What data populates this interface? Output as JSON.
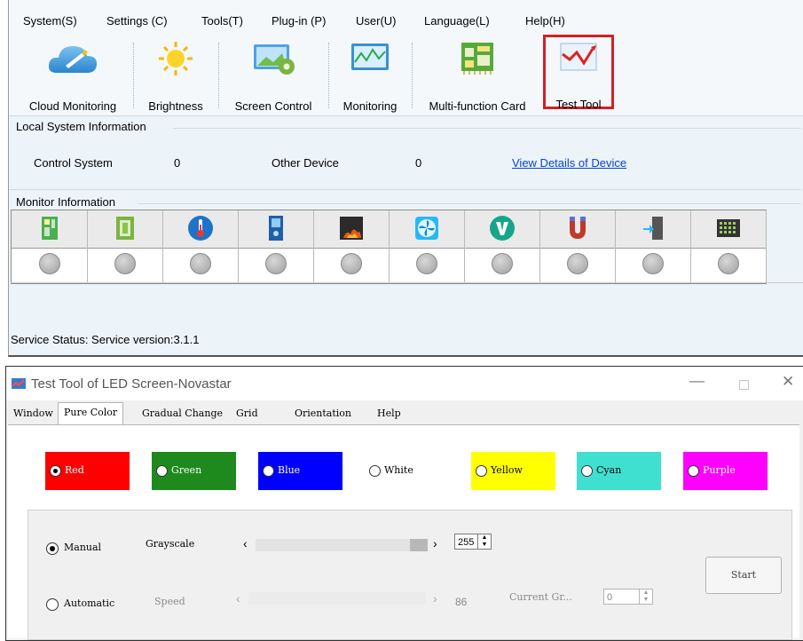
{
  "main_window": {
    "menu": [
      {
        "label": "System(S)"
      },
      {
        "label": "Settings (C)"
      },
      {
        "label": "Tools(T)"
      },
      {
        "label": "Plug-in (P)"
      },
      {
        "label": "User(U)"
      },
      {
        "label": "Language(L)"
      },
      {
        "label": "Help(H)"
      }
    ],
    "toolbar": [
      {
        "label": "Cloud Monitoring",
        "icon": "cloud-icon"
      },
      {
        "label": "Brightness",
        "icon": "sun-icon"
      },
      {
        "label": "Screen Control",
        "icon": "monitor-gear-icon"
      },
      {
        "label": "Monitoring",
        "icon": "monitor-chart-icon"
      },
      {
        "label": "Multi-function Card",
        "icon": "circuit-card-icon"
      },
      {
        "label": "Test Tool",
        "icon": "test-chart-icon",
        "highlight_color": "#d32026"
      }
    ],
    "local_info": {
      "title": "Local System Information",
      "control_system_label": "Control System",
      "control_system_value": "0",
      "other_device_label": "Other Device",
      "other_device_value": "0",
      "details_link": "View Details of Device"
    },
    "monitor_info": {
      "title": "Monitor Information",
      "columns": [
        {
          "icon": "receiving-card-icon"
        },
        {
          "icon": "module-icon"
        },
        {
          "icon": "thermometer-icon"
        },
        {
          "icon": "cabinet-icon"
        },
        {
          "icon": "smoke-icon"
        },
        {
          "icon": "fan-icon"
        },
        {
          "icon": "voltage-icon"
        },
        {
          "icon": "magnet-icon"
        },
        {
          "icon": "door-icon"
        },
        {
          "icon": "led-grid-icon"
        }
      ]
    },
    "status": "Service Status:  Service version:3.1.1"
  },
  "test_tool": {
    "title": "Test Tool of LED Screen-Novastar",
    "tabs": [
      {
        "label": "Window",
        "active": false
      },
      {
        "label": "Pure Color",
        "active": true
      },
      {
        "label": "Gradual Change",
        "active": false
      },
      {
        "label": "Grid",
        "active": false
      },
      {
        "label": "Orientation",
        "active": false
      },
      {
        "label": "Help",
        "active": false
      }
    ],
    "colors": [
      {
        "label": "Red",
        "bg": "#ff0000",
        "fg": "#ffffff",
        "selected": true
      },
      {
        "label": "Green",
        "bg": "#1e8a1e",
        "fg": "#ffffff",
        "selected": false
      },
      {
        "label": "Blue",
        "bg": "#0000ff",
        "fg": "#ffffff",
        "selected": false
      },
      {
        "label": "White",
        "bg": "#ffffff",
        "fg": "#000000",
        "selected": false
      },
      {
        "label": "Yellow",
        "bg": "#ffff00",
        "fg": "#000000",
        "selected": false
      },
      {
        "label": "Cyan",
        "bg": "#40e0d0",
        "fg": "#000000",
        "selected": false
      },
      {
        "label": "Purple",
        "bg": "#ff00ff",
        "fg": "#ffffff",
        "selected": false
      }
    ],
    "manual_label": "Manual",
    "grayscale_label": "Grayscale",
    "grayscale_value": "255",
    "automatic_label": "Automatic",
    "speed_label": "Speed",
    "speed_value": "86",
    "current_gray_label": "Current Gr...",
    "current_gray_value": "0",
    "start_label": "Start"
  }
}
